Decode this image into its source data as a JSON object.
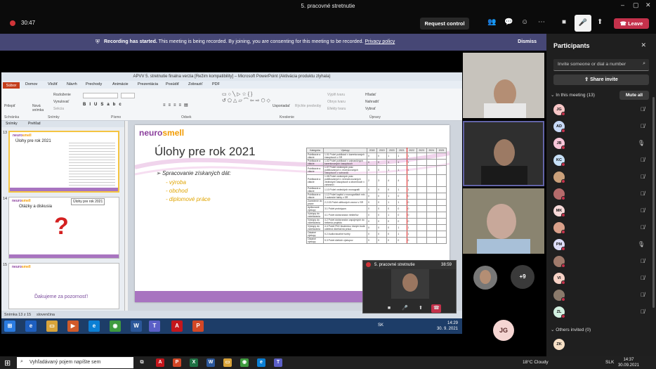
{
  "window": {
    "title": "5. pracovné stretnutie",
    "controls": [
      "–",
      "▢",
      "✕"
    ]
  },
  "toolbar": {
    "timer": "30:47",
    "request_control": "Request control",
    "leave": "Leave"
  },
  "banner": {
    "strong": "Recording has started.",
    "text": " This meeting is being recorded. By joining, you are consenting for this meeting to be recorded.",
    "policy": "Privacy policy",
    "dismiss": "Dismiss"
  },
  "ppt": {
    "title": "APVV 5. stretnutie finalna verzia [Režim kompatibility] – Microsoft PowerPoint (Aktivácia produktu zlyhala)",
    "tabs": [
      "Súbor",
      "Domov",
      "Vložiť",
      "Návrh",
      "Prechody",
      "Animácie",
      "Prezentácia",
      "Posúdiť",
      "Zobraziť",
      "PDF"
    ],
    "ribbon": {
      "vlozit": "Prilepiť",
      "nova": "Nová snímka",
      "rozlozenie": "Rozloženie",
      "vynulovat": "Vynulovať",
      "sekcia": "Sekcia",
      "usporiadat": "Usporiadať",
      "rychle": "Rýchle predvoby",
      "vypln": "Výplň tvaru",
      "obrys": "Obrys tvaru",
      "efekty": "Efekty tvaru",
      "hladat": "Hľadať",
      "nahradit": "Nahradiť",
      "vybrat": "Vybrať",
      "groups": [
        "Schránka",
        "Snímky",
        "Písmo",
        "Odsek",
        "Kreslenie",
        "Úpravy"
      ]
    },
    "left_tabs": [
      "Snímky",
      "Prehľad"
    ],
    "thumbs": [
      {
        "num": "13",
        "title": "Úlohy pre rok 2021"
      },
      {
        "num": "14",
        "title": "Otázky a diskusia",
        "tooltip": "Úlohy pre rok 2021"
      },
      {
        "num": "15",
        "title": "Ďakujeme za pozornosť!"
      }
    ],
    "slide": {
      "logo_a": "neuro",
      "logo_b": "smell",
      "title": "Úlohy pre rok 2021",
      "bullet": "Spracovanie získaných dát:",
      "subs": [
        "výroba",
        "obchod",
        "diplomové práce"
      ],
      "table_headers": [
        "Kategória",
        "Výstupy",
        "2018",
        "2019",
        "2020",
        "2021",
        "2022",
        "2023",
        "2024",
        "2025"
      ],
      "table_rows": [
        [
          "Publikácie a citácie",
          "1.01 Počet publikácií v karentovaných časopisoch v SR",
          "0",
          "0",
          "1",
          "1",
          "1",
          "",
          "",
          ""
        ],
        [
          "Publikácie a citácie",
          "1.02 Počet publikácií v zahraničných karentovaných časopisoch",
          "0",
          "0",
          "1",
          "1",
          "1",
          "",
          "",
          ""
        ],
        [
          "Publikácie a citácie",
          "1.07 Počet vedeckých prác publikovaných v recenzovaných časopisoch v zahraničí",
          "0",
          "0",
          "1",
          "1",
          "1",
          "",
          "",
          ""
        ],
        [
          "Publikácie a citácie",
          "1.08 Počet vedeckých prác publikovaných v nerecenzovaných vedeckých časopisoch a zborníkoch v zahraničí",
          "2",
          "3",
          "4",
          "4",
          "4",
          "",
          "",
          ""
        ],
        [
          "Publikácie a citácie",
          "1.10 Počet vedeckých monografií",
          "0",
          "0",
          "0",
          "1",
          "1",
          "",
          "",
          ""
        ],
        [
          "Publikácie a citácie",
          "1.12 Počet kapitol v monografiách min. 3 autorské hárky v SR",
          "0",
          "0",
          "1",
          "0",
          "0",
          "",
          "",
          ""
        ],
        [
          "Zavedenie do praxe",
          "2.2.03 Počet užitkových vzorov v SR",
          "0",
          "0",
          "1",
          "1",
          "0",
          "",
          "",
          ""
        ],
        [
          "Aplikované výstupy",
          "3.1 Počet prototypov",
          "0",
          "0",
          "0",
          "0",
          "0",
          "",
          "",
          ""
        ],
        [
          "Výstupy do vzdelávania",
          "4.1 Počet doktorandov riešiteľov",
          "0",
          "0",
          "1",
          "0",
          "0",
          "",
          "",
          ""
        ],
        [
          "Výstupy do vzdelávania",
          "4.2 Počet doktorandov zapojených do riešenia projektu",
          "0",
          "0",
          "0",
          "0",
          "0",
          "",
          "",
          ""
        ],
        [
          "Výstupy do vzdelávania",
          "4.4 Počet PhD študentov, ktorým bude udelená dizertačná práca",
          "0",
          "0",
          "0",
          "1",
          "1",
          "",
          "",
          ""
        ],
        [
          "Ostatné výstupy",
          "5.2 Audiovizuálne tvorby",
          "0",
          "0",
          "0",
          "1",
          "1",
          "",
          "",
          ""
        ],
        [
          "Ostatné výstupy",
          "5.3 Počet ďalších výstupov",
          "0",
          "0",
          "0",
          "0",
          "0",
          "",
          "",
          ""
        ]
      ]
    },
    "status": {
      "slide": "Snímka 13 z 15",
      "lang": "slovenčina",
      "zoom": "SK"
    },
    "taskbar_clock": {
      "time": "14:29",
      "date": "30. 9. 2021"
    }
  },
  "selfview": {
    "title": "5. pracovné stretnutie",
    "time": "38:59"
  },
  "tiles": {
    "more": "+9",
    "avatar_jg": "JG"
  },
  "panel": {
    "title": "Participants",
    "search_placeholder": "Invite someone or dial a number",
    "share": "Share invite",
    "in_meeting": "In this meeting (13)",
    "mute_all": "Mute all",
    "others": "Others invited (0)",
    "participants": [
      {
        "initials": "JG",
        "color": "#f7c6c7",
        "mic": "off"
      },
      {
        "initials": "AD",
        "color": "#c7d9f7",
        "mic": "off"
      },
      {
        "initials": "JB",
        "color": "#f7c6d9",
        "mic": "on"
      },
      {
        "initials": "KC",
        "color": "#c7e0f7",
        "mic": "off"
      },
      {
        "initials": "",
        "color": "#caa07a",
        "mic": "off"
      },
      {
        "initials": "",
        "color": "#b56b6b",
        "mic": "off"
      },
      {
        "initials": "MK",
        "color": "#f7d9d9",
        "mic": "off"
      },
      {
        "initials": "",
        "color": "#d9a08a",
        "mic": "off"
      },
      {
        "initials": "PM",
        "color": "#dcdcf7",
        "mic": "on"
      },
      {
        "initials": "",
        "color": "#a07a6b",
        "mic": "off"
      },
      {
        "initials": "VI",
        "color": "#f7d2c6",
        "mic": "off"
      },
      {
        "initials": "",
        "color": "#8a7a6b",
        "mic": "off"
      },
      {
        "initials": "ZL",
        "color": "#d2f0e0",
        "mic": "off"
      }
    ],
    "invited": [
      {
        "initials": "ZK",
        "color": "#f7e0c6"
      }
    ]
  },
  "os": {
    "search": "Vyhľadávaný pojem napíšte sem",
    "weather": "18°C  Cloudy",
    "lang": "SLK",
    "time": "14:37",
    "date": "30.09.2021"
  }
}
